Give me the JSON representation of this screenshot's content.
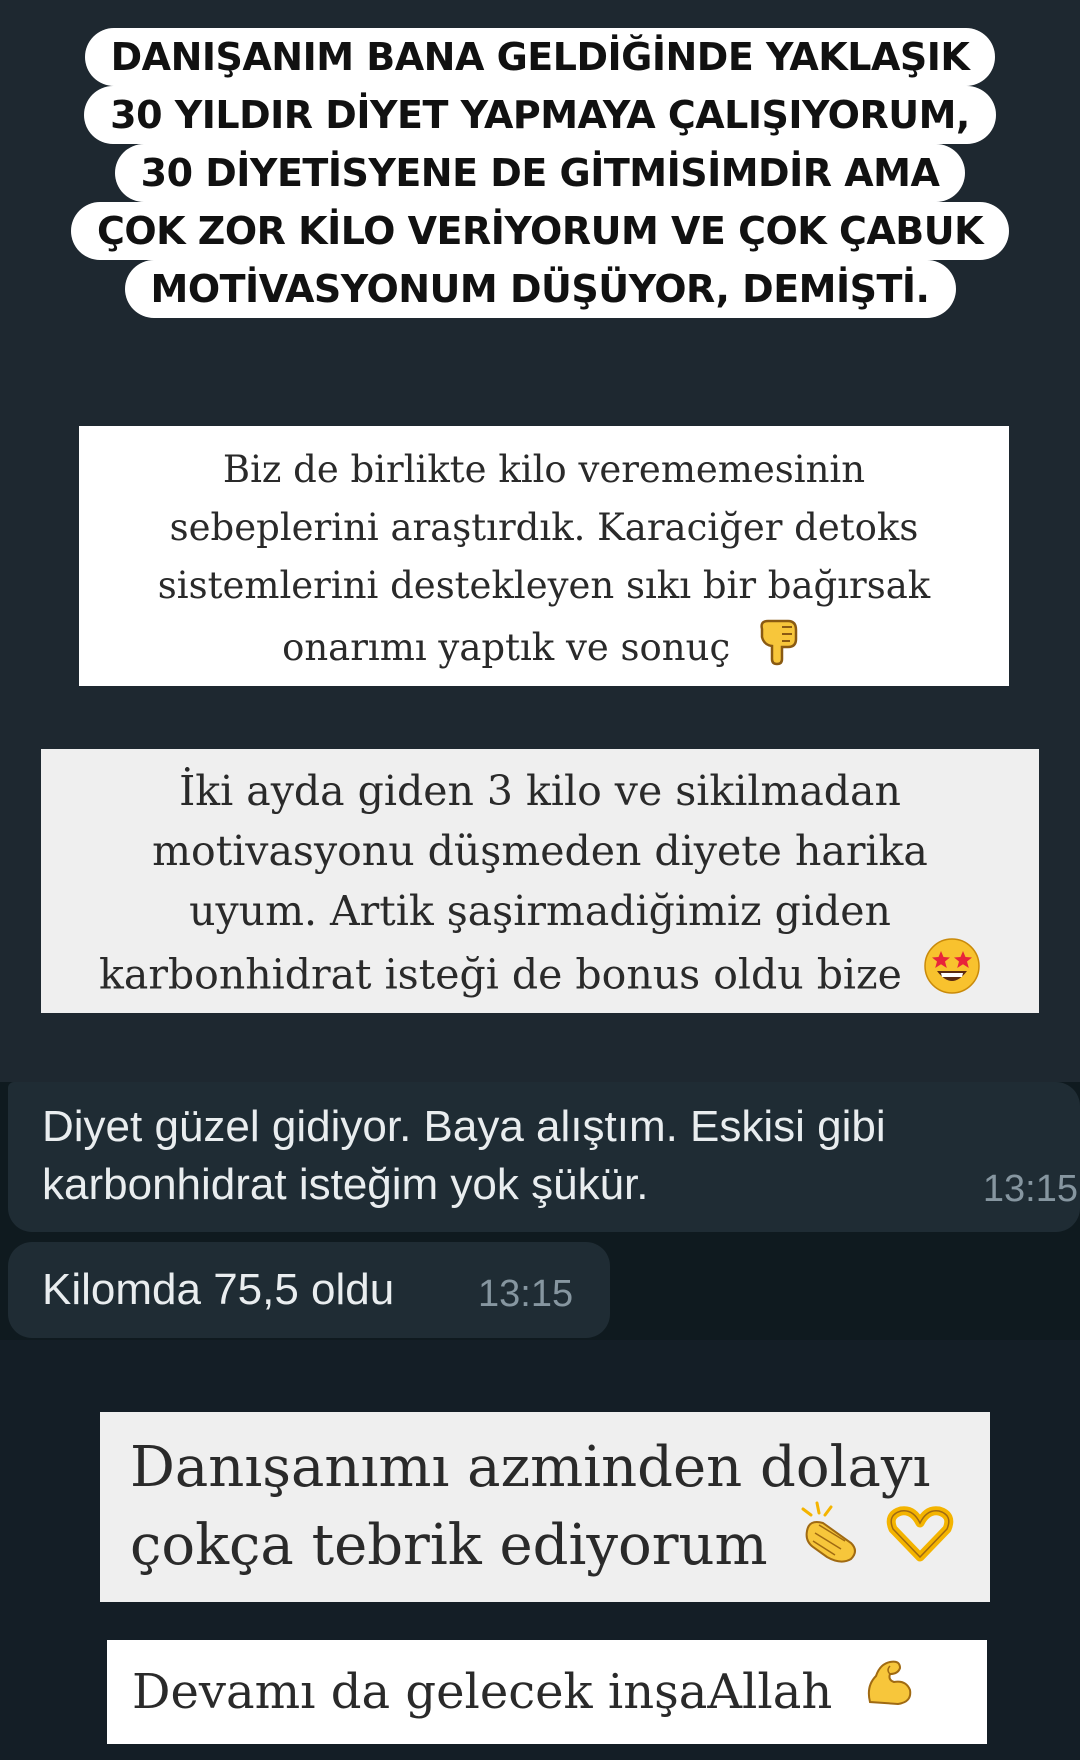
{
  "headline": {
    "lines": [
      "DANIŞANIM BANA GELDİĞİNDE YAKLAŞIK",
      "30 YILDIR DİYET YAPMAYA ÇALIŞIYORUM,",
      "30 DİYETİSYENE DE GİTMİSİMDİR AMA",
      "ÇOK ZOR KİLO VERİYORUM VE ÇOK ÇABUK",
      "MOTİVASYONUM DÜŞÜYOR, DEMİŞTİ."
    ]
  },
  "card1": {
    "lines": [
      "Biz de birlikte kilo verememesinin",
      "sebeplerini araştırdık. Karaciğer detoks",
      "sistemlerini destekleyen sıkı bir bağırsak",
      "onarımı yaptık ve sonuç"
    ],
    "emoji": "pointing-down-hand-icon"
  },
  "card2": {
    "lines": [
      "İki ayda giden 3 kilo ve sikilmadan",
      "motivasyonu düşmeden diyete harika",
      "uyum. Artik şaşirmadiğimiz giden",
      "karbonhidrat isteği de bonus oldu bize"
    ],
    "emoji": "star-struck-face-icon"
  },
  "chat": {
    "message1": {
      "lines": [
        "Diyet güzel gidiyor. Baya alıştım. Eskisi gibi",
        "karbonhidrat isteğim yok şükür."
      ],
      "time": "13:15"
    },
    "message2": {
      "text": "Kilomda 75,5 oldu",
      "time": "13:15"
    }
  },
  "card3": {
    "lines": [
      "Danışanımı azminden dolayı",
      "çokça tebrik ediyorum"
    ],
    "emojis": [
      "clapping-hands-icon",
      "heart-hands-icon"
    ]
  },
  "card4": {
    "text": "Devamı da gelecek inşaAllah",
    "emoji": "flexed-biceps-icon"
  },
  "colors": {
    "background": "#1e2830",
    "chat_bubble": "#1f2c34",
    "chat_text": "#e9edef",
    "chat_time": "#8696a0",
    "emoji_yellow": "#f4b400"
  }
}
